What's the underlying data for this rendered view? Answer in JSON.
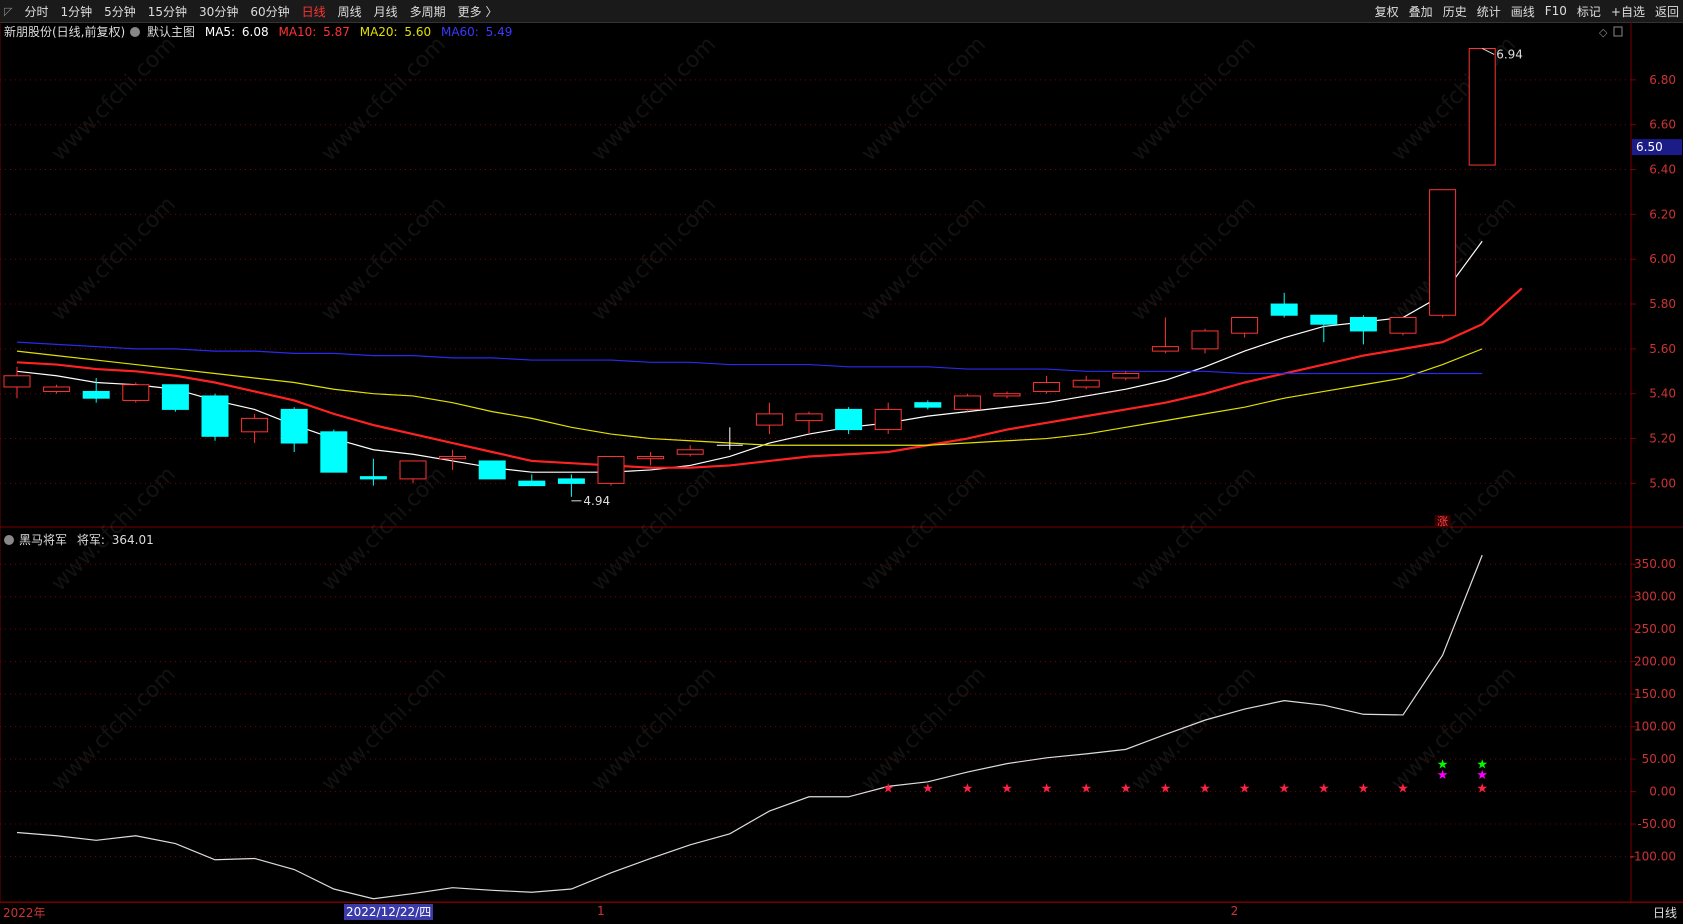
{
  "toolbar": {
    "periods": [
      "分时",
      "1分钟",
      "5分钟",
      "15分钟",
      "30分钟",
      "60分钟",
      "日线",
      "周线",
      "月线",
      "多周期",
      "更多 〉"
    ],
    "active_period": "日线",
    "tools": [
      "复权",
      "叠加",
      "历史",
      "统计",
      "画线",
      "F10",
      "标记",
      "+自选",
      "返回"
    ]
  },
  "main_legend": {
    "stock": "新朋股份(日线,前复权)",
    "template": "默认主图",
    "ma5_label": "MA5:",
    "ma5_value": "6.08",
    "ma10_label": "MA10:",
    "ma10_value": "5.87",
    "ma20_label": "MA20:",
    "ma20_value": "5.60",
    "ma60_label": "MA60:",
    "ma60_value": "5.49"
  },
  "sub_legend": {
    "indicator": "黑马将军",
    "line_label": "将军:",
    "line_value": "364.01"
  },
  "markers": {
    "high_label": "6.94",
    "low_label": "4.94",
    "current_price": "6.50",
    "zhang": "涨"
  },
  "time_axis": {
    "labels": [
      {
        "text": "2022年",
        "index": 0
      },
      {
        "text": "1",
        "index": 15
      },
      {
        "text": "2",
        "index": 31
      }
    ],
    "cursor_date": "2022/12/22/四",
    "period_label": "日线"
  },
  "colors": {
    "up": "#ff3333",
    "down": "#00ffff",
    "ma5": "#ffffff",
    "ma10": "#ff2222",
    "ma20": "#e0e000",
    "ma60": "#2a2aee",
    "indicator_line": "#dddddd",
    "star_red": "#ff2244",
    "star_green": "#00ff00",
    "star_magenta": "#ff00ff",
    "grid": "#7a0000",
    "axis_text": "#cc3333"
  },
  "chart_data": [
    {
      "type": "candlestick",
      "title": "新朋股份(日线,前复权)",
      "ylim": [
        4.85,
        6.96
      ],
      "yticks": [
        5.0,
        5.2,
        5.4,
        5.6,
        5.8,
        6.0,
        6.2,
        6.4,
        6.6,
        6.8
      ],
      "candles": [
        {
          "o": 5.43,
          "c": 5.48,
          "h": 5.52,
          "l": 5.38
        },
        {
          "o": 5.41,
          "c": 5.43,
          "h": 5.44,
          "l": 5.4
        },
        {
          "o": 5.41,
          "c": 5.38,
          "h": 5.47,
          "l": 5.36
        },
        {
          "o": 5.37,
          "c": 5.44,
          "h": 5.45,
          "l": 5.36
        },
        {
          "o": 5.44,
          "c": 5.33,
          "h": 5.44,
          "l": 5.32
        },
        {
          "o": 5.39,
          "c": 5.21,
          "h": 5.4,
          "l": 5.19
        },
        {
          "o": 5.23,
          "c": 5.29,
          "h": 5.31,
          "l": 5.18
        },
        {
          "o": 5.33,
          "c": 5.18,
          "h": 5.34,
          "l": 5.14
        },
        {
          "o": 5.23,
          "c": 5.05,
          "h": 5.24,
          "l": 5.05
        },
        {
          "o": 5.03,
          "c": 5.02,
          "h": 5.11,
          "l": 4.99
        },
        {
          "o": 5.02,
          "c": 5.1,
          "h": 5.1,
          "l": 5.0
        },
        {
          "o": 5.11,
          "c": 5.12,
          "h": 5.15,
          "l": 5.06
        },
        {
          "o": 5.1,
          "c": 5.02,
          "h": 5.1,
          "l": 5.02
        },
        {
          "o": 5.01,
          "c": 4.99,
          "h": 5.04,
          "l": 4.99
        },
        {
          "o": 5.02,
          "c": 5.0,
          "h": 5.04,
          "l": 4.94
        },
        {
          "o": 5.0,
          "c": 5.12,
          "h": 5.12,
          "l": 4.99
        },
        {
          "o": 5.11,
          "c": 5.12,
          "h": 5.14,
          "l": 5.08
        },
        {
          "o": 5.13,
          "c": 5.15,
          "h": 5.17,
          "l": 5.12
        },
        {
          "o": 5.17,
          "c": 5.17,
          "h": 5.25,
          "l": 5.15
        },
        {
          "o": 5.26,
          "c": 5.31,
          "h": 5.36,
          "l": 5.22
        },
        {
          "o": 5.28,
          "c": 5.31,
          "h": 5.32,
          "l": 5.22
        },
        {
          "o": 5.33,
          "c": 5.24,
          "h": 5.34,
          "l": 5.22
        },
        {
          "o": 5.24,
          "c": 5.33,
          "h": 5.36,
          "l": 5.22
        },
        {
          "o": 5.36,
          "c": 5.34,
          "h": 5.37,
          "l": 5.33
        },
        {
          "o": 5.33,
          "c": 5.39,
          "h": 5.4,
          "l": 5.32
        },
        {
          "o": 5.39,
          "c": 5.4,
          "h": 5.41,
          "l": 5.38
        },
        {
          "o": 5.41,
          "c": 5.45,
          "h": 5.48,
          "l": 5.4
        },
        {
          "o": 5.43,
          "c": 5.46,
          "h": 5.48,
          "l": 5.42
        },
        {
          "o": 5.47,
          "c": 5.49,
          "h": 5.5,
          "l": 5.46
        },
        {
          "o": 5.59,
          "c": 5.61,
          "h": 5.74,
          "l": 5.58
        },
        {
          "o": 5.6,
          "c": 5.68,
          "h": 5.69,
          "l": 5.58
        },
        {
          "o": 5.67,
          "c": 5.74,
          "h": 5.74,
          "l": 5.65
        },
        {
          "o": 5.8,
          "c": 5.75,
          "h": 5.85,
          "l": 5.74
        },
        {
          "o": 5.75,
          "c": 5.71,
          "h": 5.75,
          "l": 5.63
        },
        {
          "o": 5.74,
          "c": 5.68,
          "h": 5.75,
          "l": 5.62
        },
        {
          "o": 5.67,
          "c": 5.74,
          "h": 5.74,
          "l": 5.66
        },
        {
          "o": 5.75,
          "c": 6.31,
          "h": 6.31,
          "l": 5.74
        },
        {
          "o": 6.42,
          "c": 6.94,
          "h": 6.94,
          "l": 6.42
        }
      ],
      "series": [
        {
          "name": "MA5",
          "values": [
            5.5,
            5.48,
            5.45,
            5.44,
            5.42,
            5.37,
            5.33,
            5.26,
            5.2,
            5.15,
            5.13,
            5.1,
            5.07,
            5.05,
            5.05,
            5.05,
            5.06,
            5.08,
            5.12,
            5.18,
            5.22,
            5.25,
            5.27,
            5.3,
            5.32,
            5.34,
            5.36,
            5.39,
            5.42,
            5.46,
            5.52,
            5.59,
            5.65,
            5.7,
            5.72,
            5.74,
            5.84,
            6.08
          ]
        },
        {
          "name": "MA10",
          "values": [
            5.54,
            5.53,
            5.51,
            5.5,
            5.48,
            5.45,
            5.41,
            5.37,
            5.31,
            5.26,
            5.22,
            5.18,
            5.14,
            5.1,
            5.09,
            5.08,
            5.07,
            5.07,
            5.08,
            5.1,
            5.12,
            5.13,
            5.14,
            5.17,
            5.2,
            5.24,
            5.27,
            5.3,
            5.33,
            5.36,
            5.4,
            5.45,
            5.49,
            5.53,
            5.57,
            5.6,
            5.63,
            5.71,
            5.87
          ]
        },
        {
          "name": "MA20",
          "values": [
            5.59,
            5.57,
            5.55,
            5.53,
            5.51,
            5.49,
            5.47,
            5.45,
            5.42,
            5.4,
            5.39,
            5.36,
            5.32,
            5.29,
            5.25,
            5.22,
            5.2,
            5.19,
            5.18,
            5.17,
            5.17,
            5.17,
            5.17,
            5.17,
            5.18,
            5.19,
            5.2,
            5.22,
            5.25,
            5.28,
            5.31,
            5.34,
            5.38,
            5.41,
            5.44,
            5.47,
            5.53,
            5.6
          ]
        },
        {
          "name": "MA60",
          "values": [
            5.63,
            5.62,
            5.61,
            5.6,
            5.6,
            5.59,
            5.59,
            5.58,
            5.58,
            5.57,
            5.57,
            5.56,
            5.56,
            5.55,
            5.55,
            5.55,
            5.54,
            5.54,
            5.53,
            5.53,
            5.53,
            5.52,
            5.52,
            5.52,
            5.51,
            5.51,
            5.51,
            5.5,
            5.5,
            5.5,
            5.5,
            5.49,
            5.49,
            5.49,
            5.49,
            5.49,
            5.49,
            5.49
          ]
        }
      ]
    },
    {
      "type": "line",
      "title": "黑马将军",
      "ylim": [
        -170,
        395
      ],
      "yticks": [
        -100,
        -50,
        0,
        50,
        100,
        150,
        200,
        250,
        300,
        350
      ],
      "series": [
        {
          "name": "将军",
          "values": [
            -63,
            -68,
            -75,
            -68,
            -80,
            -105,
            -103,
            -120,
            -150,
            -165,
            -157,
            -148,
            -152,
            -155,
            -150,
            -125,
            -103,
            -82,
            -65,
            -30,
            -8,
            -8,
            8,
            15,
            30,
            43,
            52,
            58,
            65,
            88,
            110,
            127,
            140,
            133,
            119,
            118,
            210,
            364
          ]
        }
      ],
      "stars": [
        {
          "index": 22,
          "color": "red"
        },
        {
          "index": 23,
          "color": "red"
        },
        {
          "index": 24,
          "color": "red"
        },
        {
          "index": 25,
          "color": "red"
        },
        {
          "index": 26,
          "color": "red"
        },
        {
          "index": 27,
          "color": "red"
        },
        {
          "index": 28,
          "color": "red"
        },
        {
          "index": 29,
          "color": "red"
        },
        {
          "index": 30,
          "color": "red"
        },
        {
          "index": 31,
          "color": "red"
        },
        {
          "index": 32,
          "color": "red"
        },
        {
          "index": 33,
          "color": "red"
        },
        {
          "index": 34,
          "color": "red"
        },
        {
          "index": 35,
          "color": "red"
        },
        {
          "index": 36,
          "color": "magenta"
        },
        {
          "index": 36,
          "color": "green"
        },
        {
          "index": 37,
          "color": "red"
        },
        {
          "index": 37,
          "color": "magenta"
        },
        {
          "index": 37,
          "color": "green"
        }
      ]
    }
  ]
}
